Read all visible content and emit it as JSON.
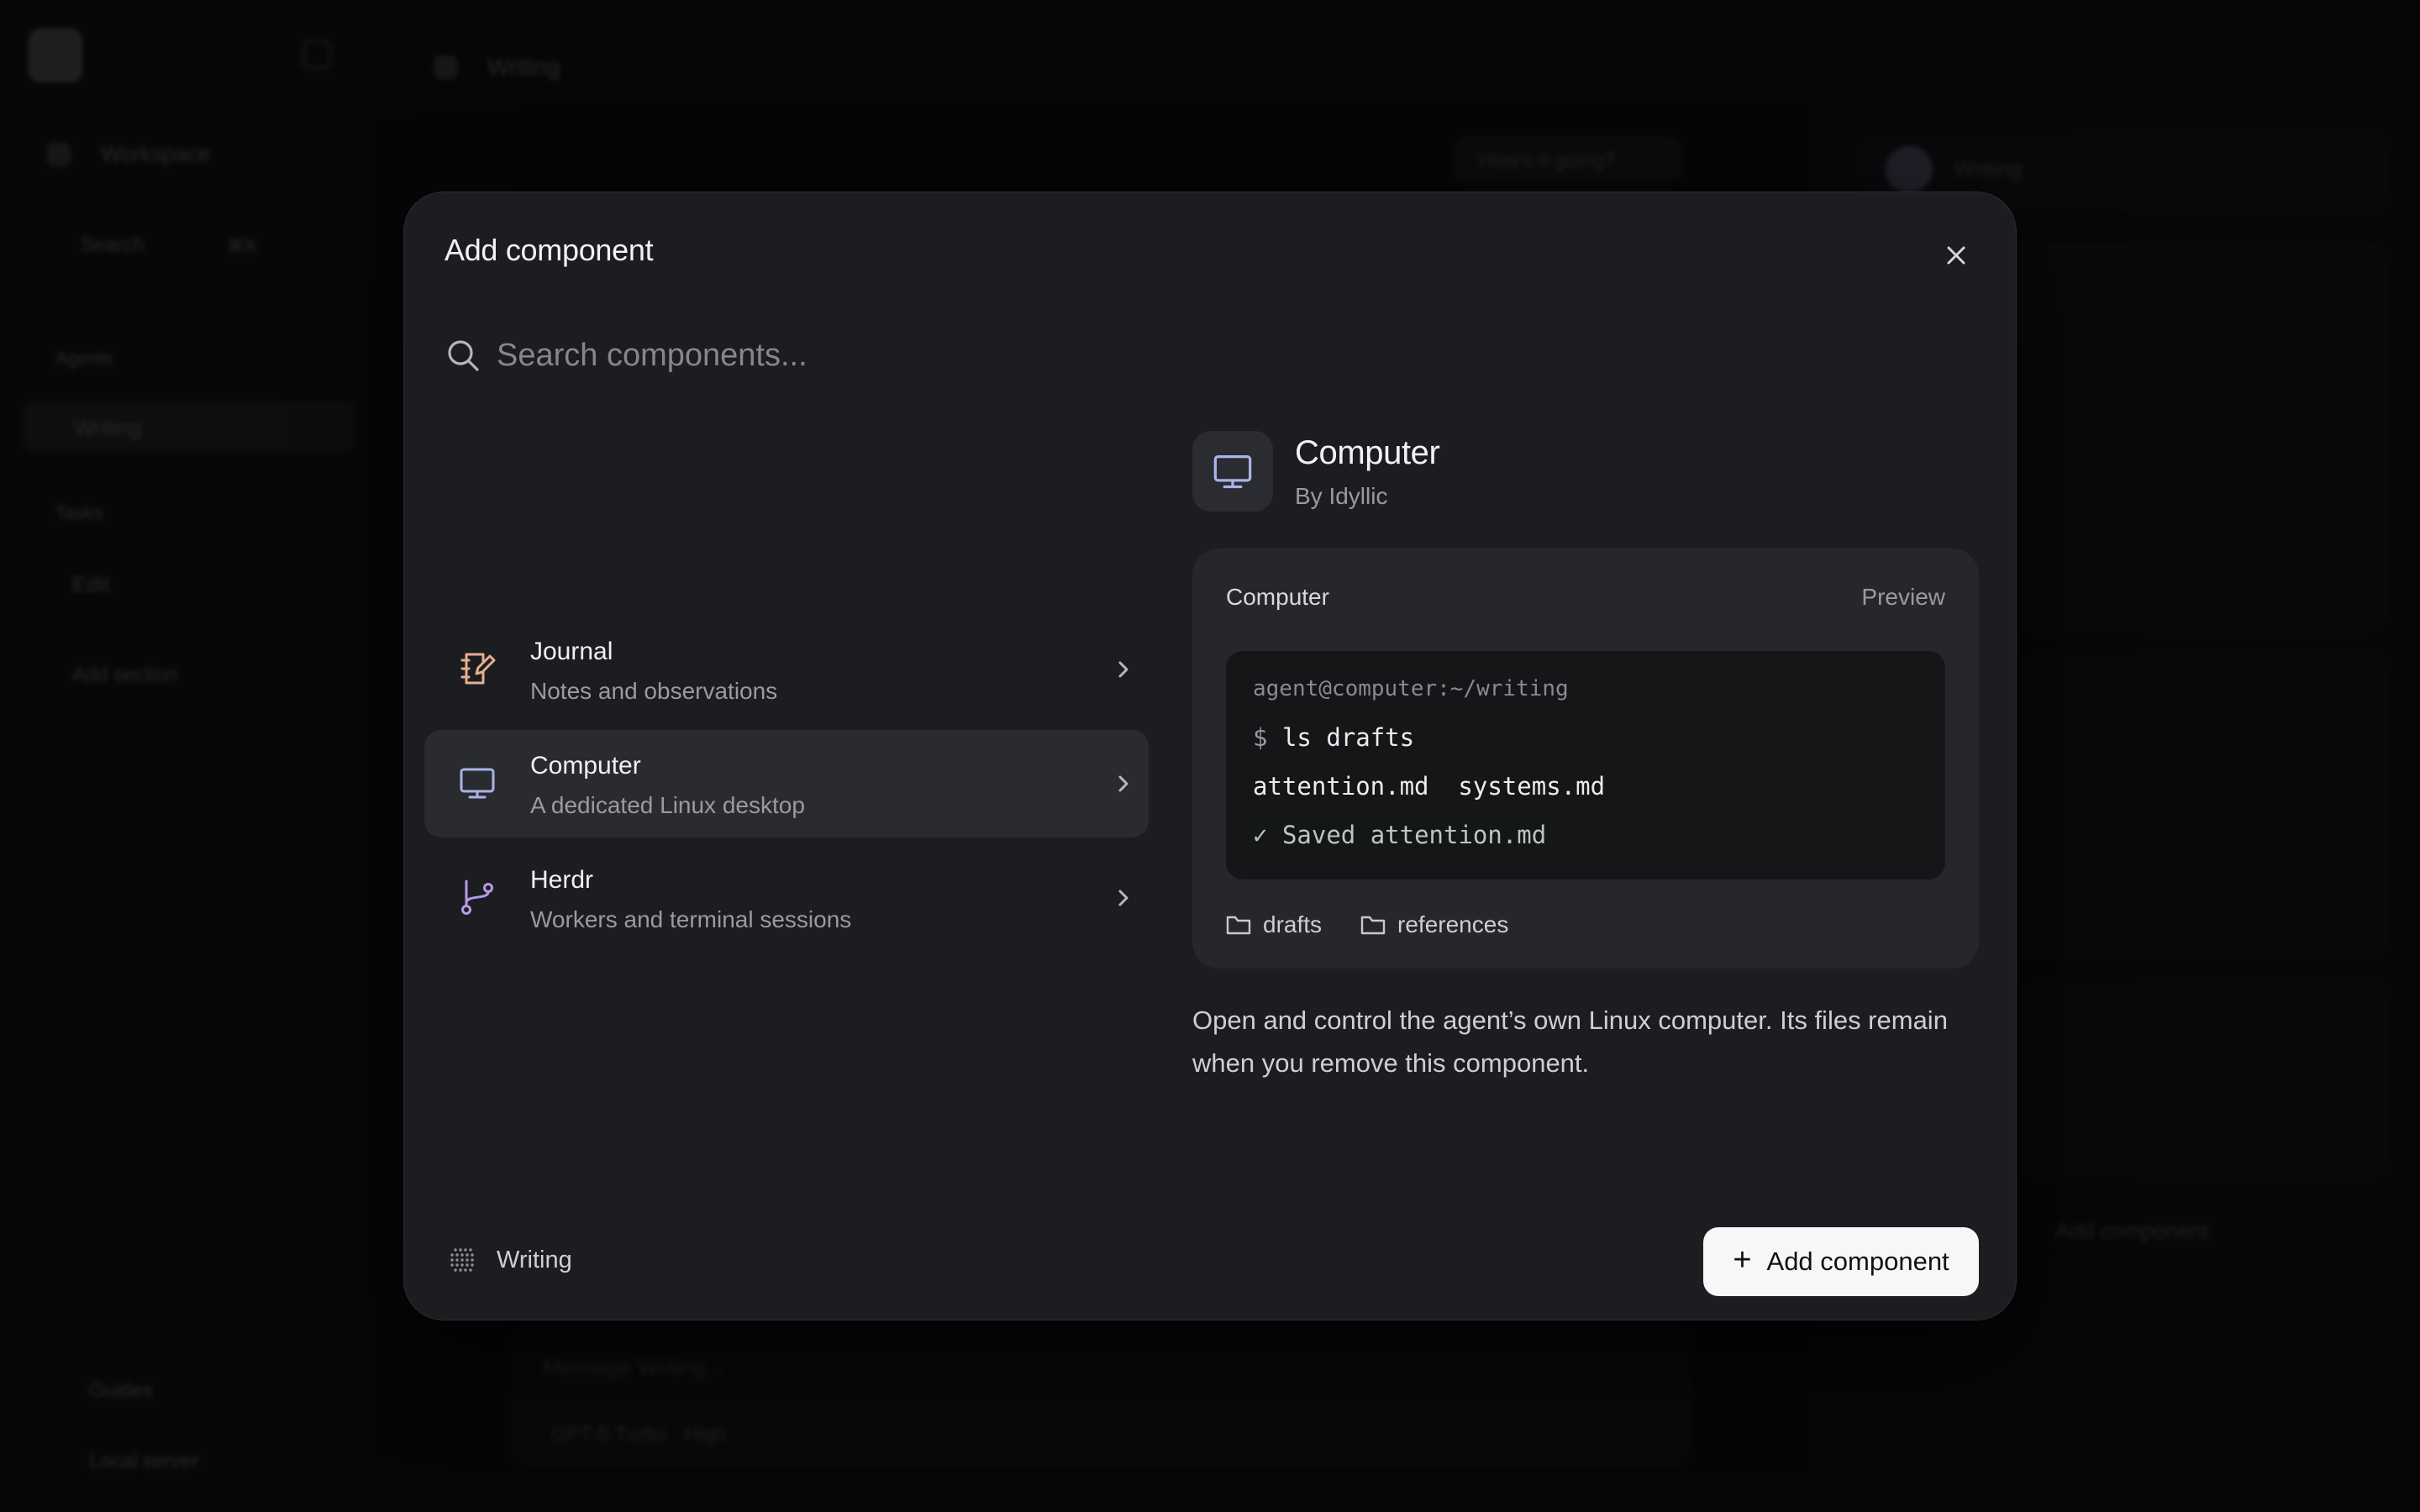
{
  "modal": {
    "title": "Add component",
    "search": {
      "placeholder": "Search components..."
    },
    "components": [
      {
        "title": "Journal",
        "description": "Notes and observations",
        "icon": "journal-icon",
        "accent": "#e3b08f"
      },
      {
        "title": "Computer",
        "description": "A dedicated Linux desktop",
        "icon": "monitor-icon",
        "accent": "#a9b4ea",
        "selected": true
      },
      {
        "title": "Herdr",
        "description": "Workers and terminal sessions",
        "icon": "branch-icon",
        "accent": "#b59ae8"
      }
    ],
    "detail": {
      "name": "Computer",
      "author": "By Idyllic",
      "preview": {
        "label": "Computer",
        "tag": "Preview",
        "terminal": {
          "prompt": "agent@computer:~/writing",
          "dollar": "$",
          "command": "ls drafts",
          "output": "attention.md  systems.md",
          "check": "✓",
          "status": "Saved attention.md"
        },
        "folders": [
          "drafts",
          "references"
        ]
      },
      "description": "Open and control the agent’s own Linux computer. Its files remain when you remove this component."
    },
    "footer": {
      "workspace": "Writing",
      "add_label": "Add component",
      "add_glyph": "+"
    }
  },
  "background": {
    "sidebar_title": "Workspace",
    "search_label": "Search",
    "search_shortcut": "⌘K",
    "section_agents": "Agents",
    "agent_writing": "Writing",
    "section_tasks": "Tasks",
    "task_item": "Edit",
    "add_section": "Add section",
    "bottom_item_1": "Guides",
    "bottom_item_2": "Local server",
    "main_title": "Writing",
    "pill": "How's it going?",
    "composer_placeholder": "Message Writing...",
    "composer_model": "GPT-5 Turbo  ·  High",
    "right_title": "Writing",
    "right_add": "Add component"
  }
}
